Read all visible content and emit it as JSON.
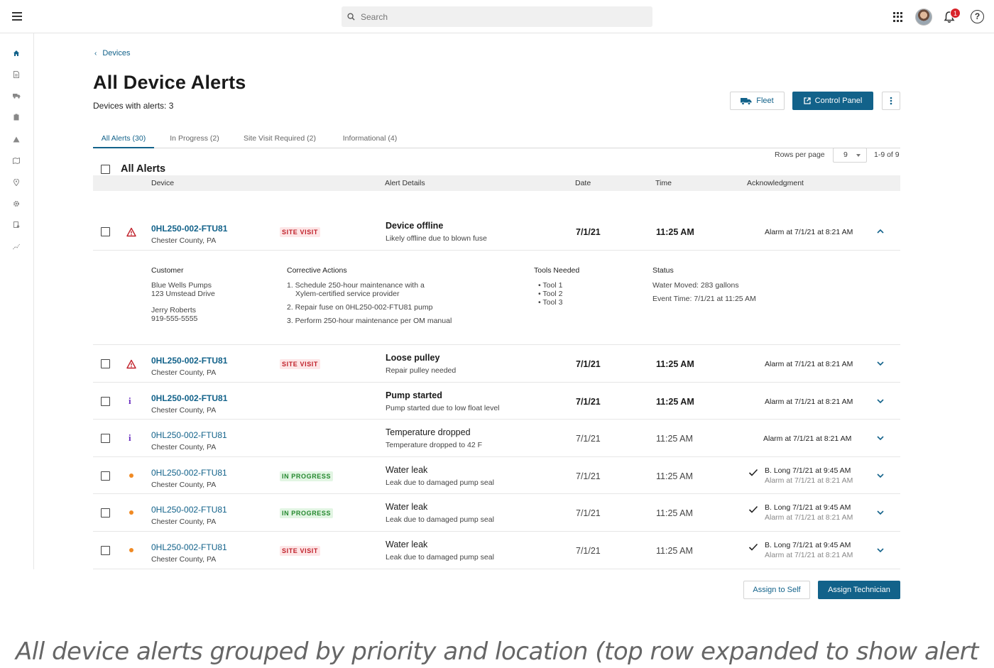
{
  "search": {
    "placeholder": "Search"
  },
  "notifications": {
    "count": "1"
  },
  "help": {
    "label": "?"
  },
  "breadcrumb": {
    "label": "Devices"
  },
  "page": {
    "title": "All Device Alerts",
    "subtitle": "Devices with alerts: 3"
  },
  "actions": {
    "fleet": "Fleet",
    "control_panel": "Control Panel"
  },
  "tabs": [
    {
      "label": "All Alerts (30)"
    },
    {
      "label": "In Progress (2)"
    },
    {
      "label": "Site Visit Required (2)"
    },
    {
      "label": "Informational (4)"
    }
  ],
  "pagination": {
    "rows_label": "Rows per page",
    "rows_value": "9",
    "range": "1-9 of 9"
  },
  "table": {
    "section_title": "All Alerts",
    "columns": [
      "Device",
      "Alert Details",
      "Date",
      "Time",
      "Acknowledgment"
    ],
    "rows": [
      {
        "device": "0HL250-002-FTU81",
        "location": "Chester County, PA",
        "tag": "SITE VISIT",
        "title": "Device offline",
        "detail": "Likely offline due to blown fuse",
        "date": "7/1/21",
        "time": "11:25 AM",
        "ack": "Alarm at 7/1/21 at 8:21 AM"
      },
      {
        "device": "0HL250-002-FTU81",
        "location": "Chester County, PA",
        "tag": "SITE VISIT",
        "title": "Loose pulley",
        "detail": "Repair pulley needed",
        "date": "7/1/21",
        "time": "11:25 AM",
        "ack": "Alarm at 7/1/21 at 8:21 AM"
      },
      {
        "device": "0HL250-002-FTU81",
        "location": "Chester County, PA",
        "title": "Pump started",
        "detail": "Pump started due to low float level",
        "date": "7/1/21",
        "time": "11:25 AM",
        "ack": "Alarm at 7/1/21 at 8:21 AM"
      },
      {
        "device": "0HL250-002-FTU81",
        "location": "Chester County, PA",
        "title": "Temperature dropped",
        "detail": "Temperature dropped to 42 F",
        "date": "7/1/21",
        "time": "11:25 AM",
        "ack": "Alarm at 7/1/21 at 8:21 AM"
      },
      {
        "device": "0HL250-002-FTU81",
        "location": "Chester County, PA",
        "tag": "IN PROGRESS",
        "title": "Water leak",
        "detail": "Leak due to damaged pump seal",
        "date": "7/1/21",
        "time": "11:25 AM",
        "ack": "B. Long 7/1/21 at 9:45 AM",
        "ack2": "Alarm at 7/1/21 at 8:21 AM"
      },
      {
        "device": "0HL250-002-FTU81",
        "location": "Chester County, PA",
        "tag": "IN PROGRESS",
        "title": "Water leak",
        "detail": "Leak due to damaged pump seal",
        "date": "7/1/21",
        "time": "11:25 AM",
        "ack": "B. Long 7/1/21 at 9:45 AM",
        "ack2": "Alarm at 7/1/21 at 8:21 AM"
      },
      {
        "device": "0HL250-002-FTU81",
        "location": "Chester County, PA",
        "tag": "SITE VISIT",
        "title": "Water leak",
        "detail": "Leak due to damaged pump seal",
        "date": "7/1/21",
        "time": "11:25 AM",
        "ack": "B. Long 7/1/21 at 9:45 AM",
        "ack2": "Alarm at 7/1/21 at 8:21 AM"
      }
    ]
  },
  "details": {
    "customer_label": "Customer",
    "customer_company": "Blue Wells Pumps",
    "customer_address": "123 Umstead Drive",
    "customer_contact": "Jerry Roberts",
    "customer_phone": "919-555-5555",
    "corrective_label": "Corrective Actions",
    "corrective": [
      "1. Schedule 250-hour maintenance with a",
      "Xylem-certified service provider",
      "2. Repair fuse on 0HL250-002-FTU81 pump",
      "3. Perform 250-hour maintenance per OM manual"
    ],
    "tools_label": "Tools Needed",
    "tools": [
      "Tool 1",
      "Tool 2",
      "Tool 3"
    ],
    "status_label": "Status",
    "status": [
      "Water Moved: 283 gallons",
      "Event Time: 7/1/21 at 11:25 AM"
    ]
  },
  "footer": {
    "assign_self": "Assign to Self",
    "assign_tech": "Assign Technician"
  },
  "caption": "All device alerts grouped by priority and location (top row expanded to show alert details)",
  "colors": {
    "primary": "#12628a",
    "site_visit": "#c0202a",
    "in_progress": "#24882e",
    "info": "#6a2fc0",
    "dot": "#f08a24"
  }
}
